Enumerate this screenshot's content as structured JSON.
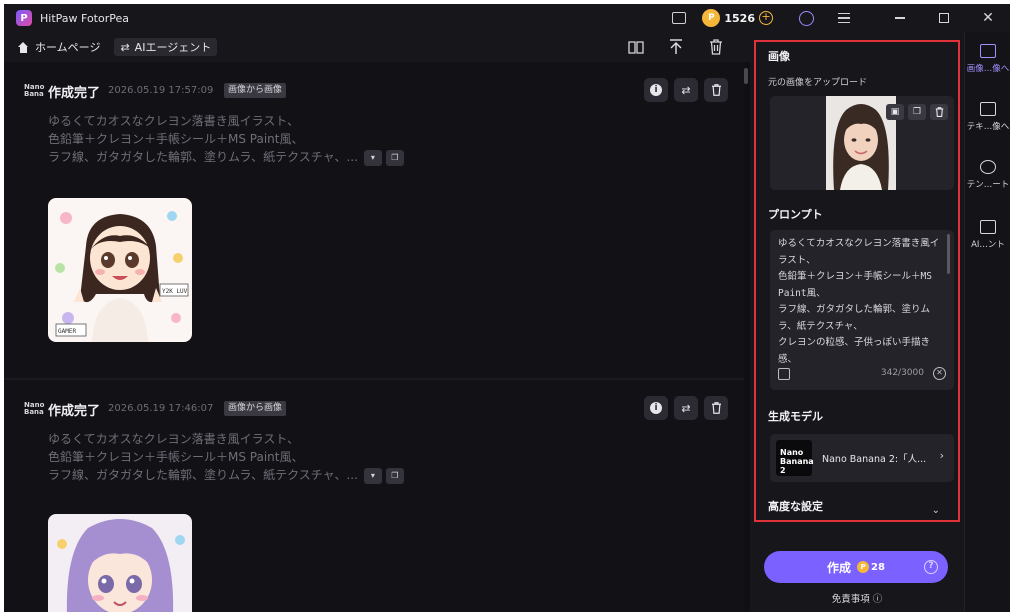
{
  "app": {
    "title": "HitPaw FotorPea",
    "credits": "1526"
  },
  "toolbar": {
    "home_label": "ホームページ",
    "agent_label": "AIエージェント"
  },
  "feed": {
    "cards": [
      {
        "title": "作成完了",
        "date": "2026.05.19  17:57:09",
        "tag": "画像から画像",
        "prompt_lines": [
          "ゆるくてカオスなクレヨン落書き風イラスト、",
          "色鉛筆＋クレヨン＋手帳シール＋MS Paint風、",
          "ラフ線、ガタガタした輪郭、塗りムラ、紙テクスチャ、..."
        ]
      },
      {
        "title": "作成完了",
        "date": "2026.05.19  17:46:07",
        "tag": "画像から画像",
        "prompt_lines": [
          "ゆるくてカオスなクレヨン落書き風イラスト、",
          "色鉛筆＋クレヨン＋手帳シール＋MS Paint風、",
          "ラフ線、ガタガタした輪郭、塗りムラ、紙テクスチャ、..."
        ]
      }
    ]
  },
  "panel": {
    "image_title": "画像",
    "upload_label": "元の画像をアップロード",
    "prompt_title": "プロンプト",
    "prompt_text": "ゆるくてカオスなクレヨン落書き風イラスト、\n色鉛筆＋クレヨン＋手帳シール＋MS Paint風、\nラフ線、ガタガタした輪郭、塗りムラ、紙テクスチャ、\nクレヨンの粒感、子供っぽい手描き感、",
    "char_count": "342/3000",
    "model_title": "生成モデル",
    "model_name": "Nano Banana 2:「人...",
    "model_logo": "Nano Banana 2",
    "advanced_title": "高度な設定",
    "generate_label": "作成",
    "generate_cost": "28",
    "disclaimer": "免責事項"
  },
  "rail": {
    "items": [
      {
        "label": "画像…像へ",
        "icon": "image-to-image-icon",
        "active": true
      },
      {
        "label": "テキ…像へ",
        "icon": "text-to-image-icon",
        "active": false
      },
      {
        "label": "テン…ート",
        "icon": "template-icon",
        "active": false
      },
      {
        "label": "AI…ント",
        "icon": "ai-agent-icon",
        "active": false
      }
    ]
  },
  "colors": {
    "accent": "#7b61ff",
    "highlight_border": "#e0323a",
    "coin": "#f4b73a"
  }
}
